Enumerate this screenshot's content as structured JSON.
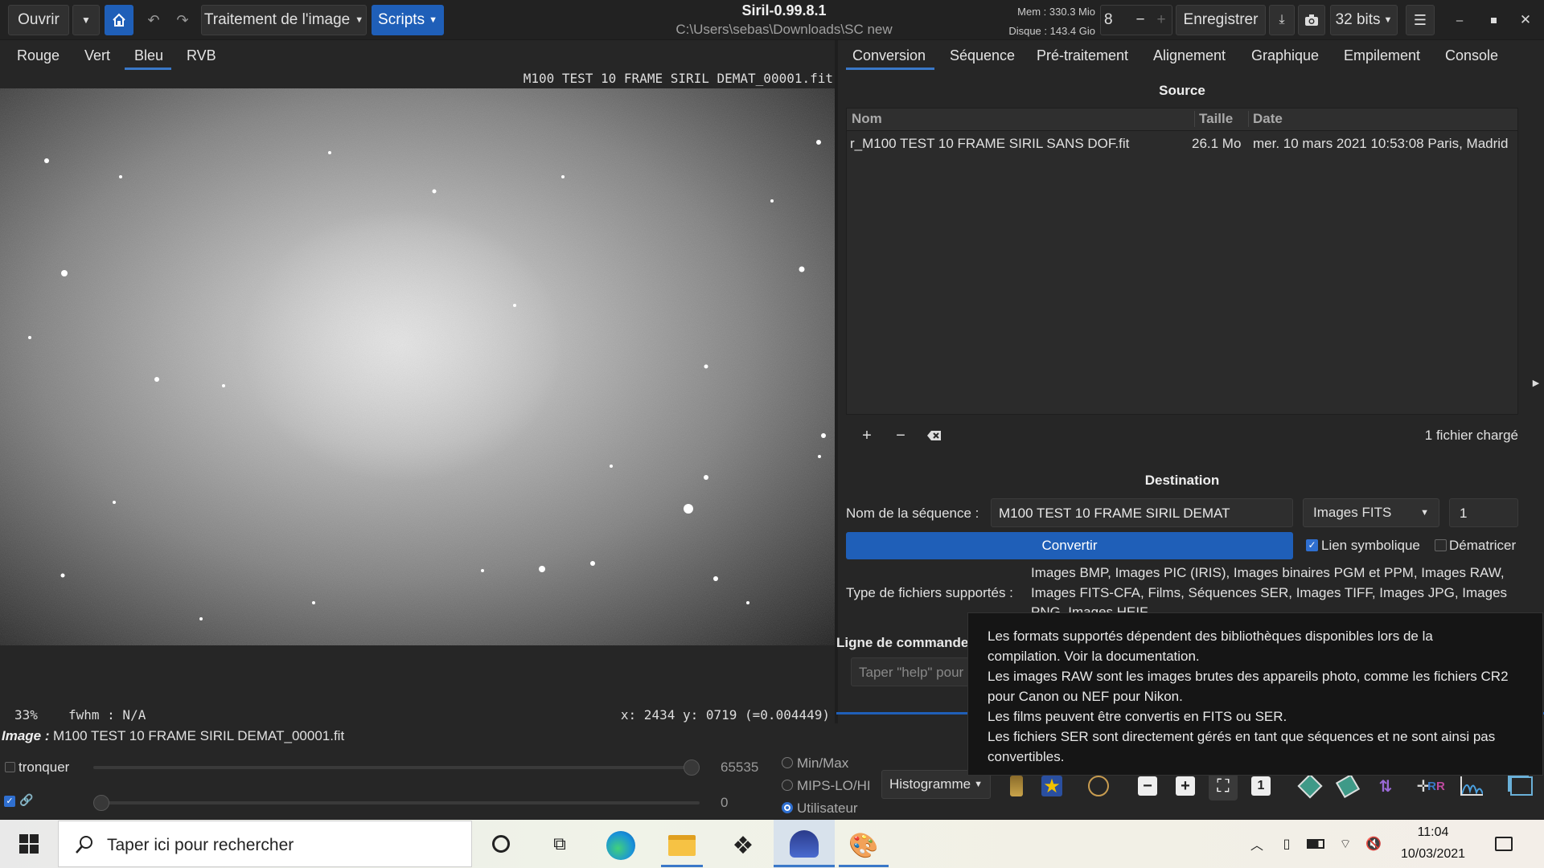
{
  "header": {
    "open_label": "Ouvrir",
    "image_processing_label": "Traitement de l'image",
    "scripts_label": "Scripts",
    "app_title": "Siril-0.99.8.1",
    "path": "C:\\Users\\sebas\\Downloads\\SC new",
    "mem_label": "Mem : 330.3 Mio",
    "disk_label": "Disque : 143.4 Gio",
    "threads_value": "8",
    "save_label": "Enregistrer",
    "bit_depth_label": "32 bits"
  },
  "channels": {
    "tabs": [
      "Rouge",
      "Vert",
      "Bleu",
      "RVB"
    ],
    "active": "Bleu"
  },
  "viewer": {
    "filename": "M100 TEST 10 FRAME SIRIL DEMAT_00001.fit",
    "zoom": "33%",
    "fwhm": "fwhm : N/A",
    "coords": "x: 2434 y: 0719 (=0.004449)"
  },
  "panel_tabs": [
    "Conversion",
    "Séquence",
    "Pré-traitement",
    "Alignement",
    "Graphique",
    "Empilement",
    "Console"
  ],
  "source": {
    "title": "Source",
    "columns": [
      "Nom",
      "Taille",
      "Date"
    ],
    "rows": [
      {
        "name": "r_M100 TEST 10 FRAME SIRIL SANS DOF.fit",
        "size": "26.1 Mo",
        "date": "mer. 10 mars 2021 10:53:08 Paris, Madrid"
      }
    ],
    "count": "1 fichier chargé"
  },
  "destination": {
    "title": "Destination",
    "seq_label": "Nom de la séquence :",
    "seq_value": "M100 TEST 10 FRAME SIRIL DEMAT",
    "format": "Images FITS",
    "start_index": "1",
    "convert_label": "Convertir",
    "symlink_label": "Lien symbolique",
    "debayer_label": "Dématricer",
    "types_label": "Type de fichiers supportés :",
    "types_line1": "Images BMP, Images PIC (IRIS), Images binaires PGM et PPM, Images RAW,",
    "types_line2": "Images FITS-CFA, Films, Séquences SER, Images TIFF, Images JPG, Images",
    "types_line3": "PNG, Images HEIF"
  },
  "command": {
    "title": "Ligne de commande",
    "placeholder": "Taper \"help\" pour"
  },
  "tooltip": {
    "lines": [
      "Les formats supportés dépendent des bibliothèques disponibles lors de la",
      "compilation. Voir la documentation.",
      "Les images RAW sont les images brutes des appareils photo, comme les fichiers CR2",
      "pour Canon ou NEF pour Nikon.",
      "Les films peuvent être convertis en FITS ou SER.",
      "Les fichiers SER sont directement gérés en tant que séquences et ne sont ainsi pas",
      "convertibles."
    ]
  },
  "status": {
    "image_prefix": "Image :",
    "image_name": "M100 TEST 10 FRAME SIRIL DEMAT_00001.fit"
  },
  "sliders": {
    "clip_label": "tronquer",
    "max_value": "65535",
    "min_value": "0",
    "high_fraction": 1.0,
    "low_fraction": 0.0,
    "mode_minmax": "Min/Max",
    "mode_mips": "MIPS-LO/HI",
    "mode_user": "Utilisateur",
    "display_mode": "Histogramme"
  },
  "taskbar": {
    "search_placeholder": "Taper ici pour rechercher",
    "time": "11:04",
    "date": "10/03/2021"
  },
  "colors": {
    "accent": "#1f5fb8",
    "tab_underline": "#3a78c8",
    "panel_bg": "#262626"
  }
}
